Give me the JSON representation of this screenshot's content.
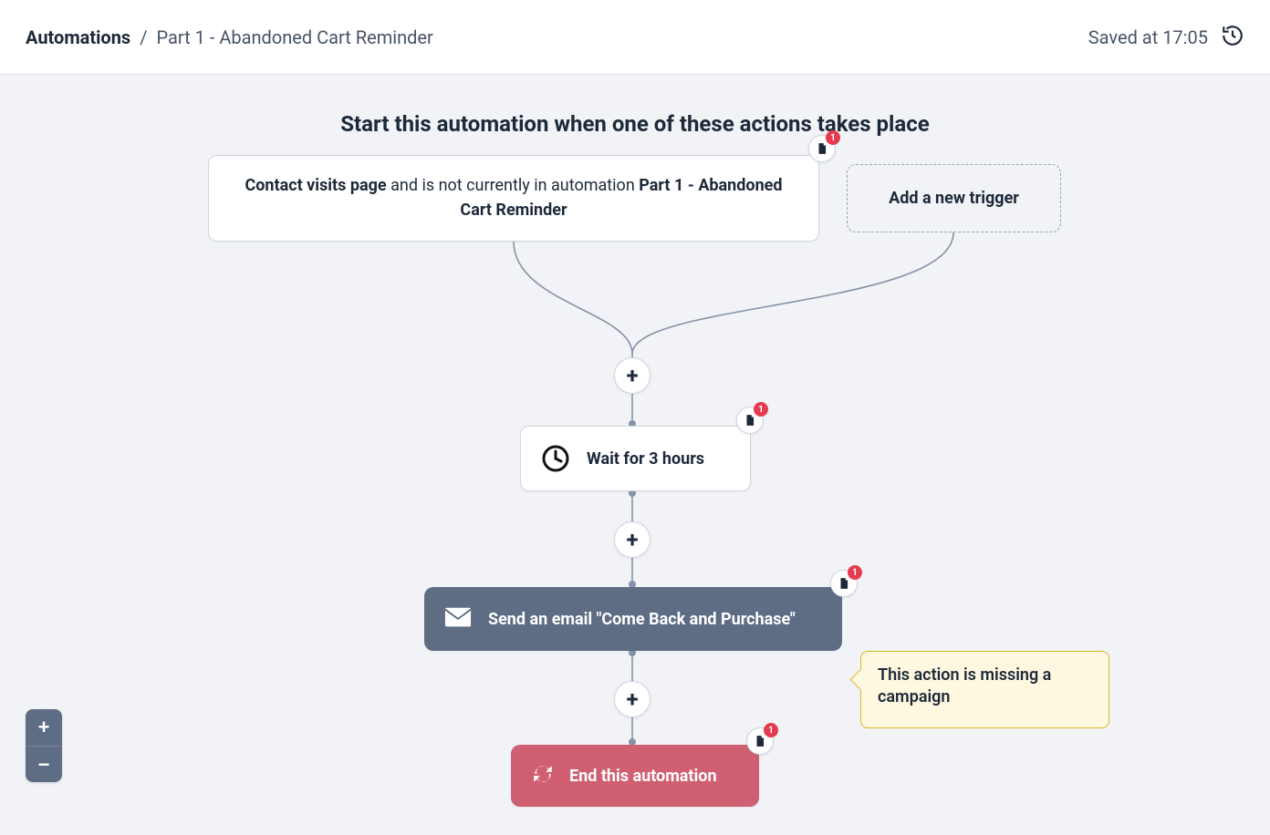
{
  "header": {
    "breadcrumb_root": "Automations",
    "breadcrumb_sep": "/",
    "breadcrumb_leaf": "Part 1 - Abandoned Cart Reminder",
    "saved_label": "Saved at 17:05"
  },
  "canvas": {
    "title": "Start this automation when one of these actions takes place",
    "trigger": {
      "prefix_bold": "Contact visits page",
      "middle_plain": " and is not currently in automation ",
      "suffix_bold": "Part 1 - Abandoned Cart Reminder",
      "badge_count": "1"
    },
    "add_trigger_label": "Add a new trigger",
    "wait": {
      "label": "Wait for 3 hours",
      "badge_count": "1"
    },
    "email": {
      "label": "Send an email \"Come Back and Purchase\"",
      "badge_count": "1"
    },
    "end": {
      "label": "End this automation",
      "badge_count": "1"
    },
    "warning": "This action is missing a campaign",
    "plus_glyph": "+",
    "zoom": {
      "in": "+",
      "out": "−"
    }
  }
}
